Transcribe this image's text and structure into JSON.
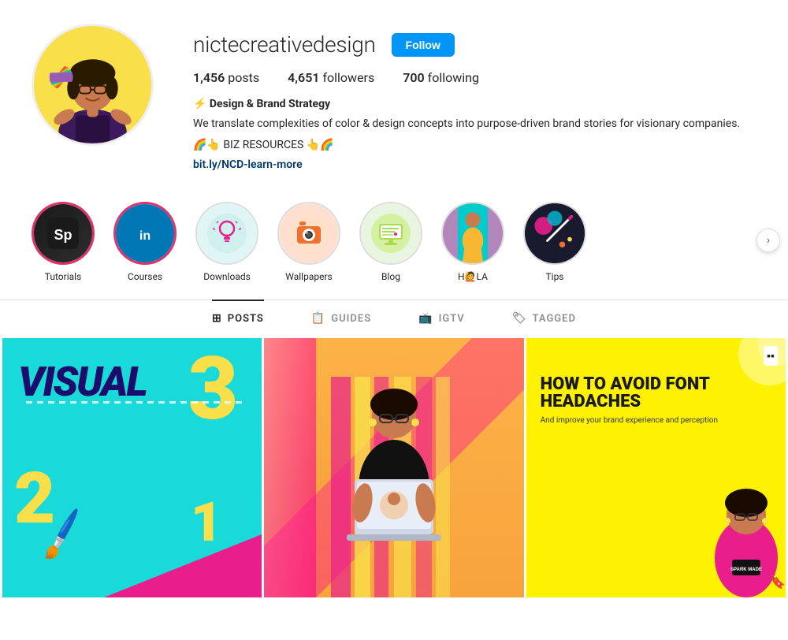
{
  "profile": {
    "username": "nictecreativedesign",
    "follow_label": "Follow",
    "stats": {
      "posts_count": "1,456",
      "posts_label": "posts",
      "followers_count": "4,651",
      "followers_label": "followers",
      "following_count": "700",
      "following_label": "following"
    },
    "bio": {
      "lightning_icon": "⚡",
      "name": "Design & Brand Strategy",
      "description": "We translate complexities of color & design concepts into purpose-driven brand stories for visionary companies.",
      "link_label": "🌈👆 BIZ RESOURCES 👆🌈",
      "link_url": "bit.ly/NCD-learn-more"
    }
  },
  "highlights": [
    {
      "id": "tutorials",
      "label": "Tutorials",
      "icon": "Sp",
      "type": "sp"
    },
    {
      "id": "courses",
      "label": "Courses",
      "icon": "in",
      "type": "in"
    },
    {
      "id": "downloads",
      "label": "Downloads",
      "icon": "💡",
      "type": "teal"
    },
    {
      "id": "wallpapers",
      "label": "Wallpapers",
      "icon": "📷",
      "type": "orange"
    },
    {
      "id": "blog",
      "label": "Blog",
      "icon": "🖥",
      "type": "lime"
    },
    {
      "id": "hola",
      "label": "HOLA",
      "icon": "👩",
      "type": "photo"
    },
    {
      "id": "tips",
      "label": "Tips",
      "icon": "🎨",
      "type": "tips"
    }
  ],
  "tabs": [
    {
      "id": "posts",
      "label": "POSTS",
      "icon": "⊞",
      "active": true
    },
    {
      "id": "guides",
      "label": "GUIDES",
      "icon": "📋",
      "active": false
    },
    {
      "id": "igtv",
      "label": "IGTV",
      "icon": "📺",
      "active": false
    },
    {
      "id": "tagged",
      "label": "TAGGED",
      "icon": "🏷",
      "active": false
    }
  ],
  "grid_posts": [
    {
      "id": "post1",
      "type": "visual321",
      "main_text": "VISUAL",
      "num3": "3",
      "num2": "2",
      "num1": "1"
    },
    {
      "id": "post2",
      "type": "person_laptop",
      "description": "Person holding laptop with sticker"
    },
    {
      "id": "post3",
      "type": "font_headaches",
      "title": "HOW TO AVOID FONT HEADACHES",
      "subtitle": "And improve your brand experience and perception"
    }
  ],
  "colors": {
    "follow_btn": "#0095f6",
    "active_tab_border": "#262626",
    "post1_bg": "#1ad9d9",
    "post1_text_color": "#1a0d6b",
    "post1_numbers_color": "#f9e04b",
    "post1_triangle": "#e91e8c",
    "post3_bg": "#fef200"
  }
}
